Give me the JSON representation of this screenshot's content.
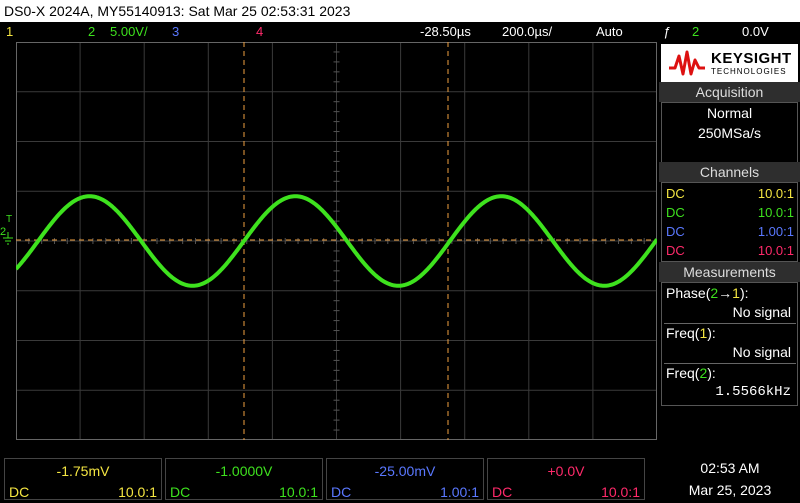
{
  "title": "DS0-X 2024A, MY55140913: Sat Mar 25 02:53:31 2023",
  "topbar": {
    "ch1": "1",
    "ch2": "2",
    "ch2_scale": "5.00V/",
    "ch3": "3",
    "ch4": "4",
    "time_offset": "-28.50µs",
    "time_scale": "200.0µs/",
    "trigger_mode": "Auto",
    "trigger_symbol": "ƒ",
    "trigger_channel": "2",
    "trigger_level": "0.0V"
  },
  "colors": {
    "ch1": "#f5e642",
    "ch2": "#3ee21e",
    "ch3": "#5a78ff",
    "ch4": "#ff2a6a",
    "marker": "#f0a040"
  },
  "waveform": {
    "channel": "2",
    "shape": "sine",
    "frequency_hz": 1556.6,
    "amplitude_divisions": 0.9,
    "offset_divisions": 0
  },
  "graticule_markers": {
    "ground_label": "2",
    "trigger_label": "T"
  },
  "panel": {
    "logo_name": "KEYSIGHT",
    "logo_sub": "TECHNOLOGIES",
    "acquisition_header": "Acquisition",
    "acquisition_mode": "Normal",
    "sample_rate": "250MSa/s",
    "channels_header": "Channels",
    "channels": [
      {
        "coupling": "DC",
        "probe": "10.0:1"
      },
      {
        "coupling": "DC",
        "probe": "10.0:1"
      },
      {
        "coupling": "DC",
        "probe": "1.00:1"
      },
      {
        "coupling": "DC",
        "probe": "10.0:1"
      }
    ],
    "measurements_header": "Measurements",
    "measurements": [
      {
        "label_pre": "Phase(",
        "ch_a": "2",
        "arrow": "→",
        "ch_b": "1",
        "label_post": "):",
        "value": "No signal"
      },
      {
        "label_pre": "Freq(",
        "ch_a": "1",
        "label_post": "):",
        "value": "No signal"
      },
      {
        "label_pre": "Freq(",
        "ch_a": "2",
        "label_post": "):",
        "value": "1.5566kHz"
      }
    ]
  },
  "bottom": {
    "cells": [
      {
        "value": "-1.75mV",
        "coupling": "DC",
        "probe": "10.0:1"
      },
      {
        "value": "-1.0000V",
        "coupling": "DC",
        "probe": "10.0:1"
      },
      {
        "value": "-25.00mV",
        "coupling": "DC",
        "probe": "1.00:1"
      },
      {
        "value": "+0.0V",
        "coupling": "DC",
        "probe": "10.0:1"
      }
    ],
    "time": "02:53 AM",
    "date": "Mar 25, 2023"
  }
}
